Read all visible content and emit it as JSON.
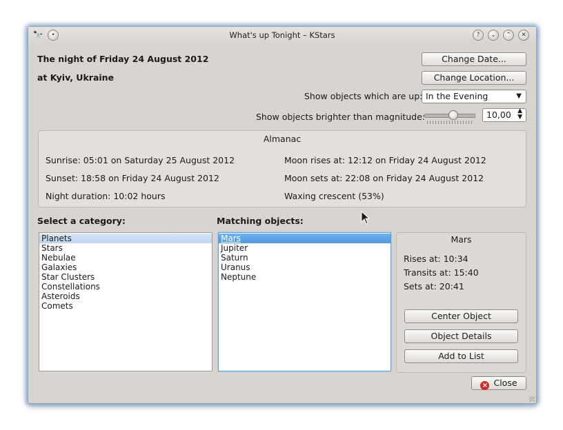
{
  "window": {
    "title": "What's up Tonight – KStars"
  },
  "header": {
    "night_label": "The night of Friday 24 August 2012",
    "location_label": "at Kyiv, Ukraine",
    "change_date": "Change Date...",
    "change_location": "Change Location...",
    "show_objects_label": "Show objects which are up:",
    "time_selected": "In the Evening",
    "brighter_label": "Show objects brighter than magnitude:",
    "magnitude_value": "10,00",
    "magnitude_slider_fraction": 0.6
  },
  "almanac": {
    "title": "Almanac",
    "sunrise": "Sunrise: 05:01 on Saturday 25 August 2012",
    "sunset": "Sunset: 18:58 on Friday 24 August 2012",
    "night_duration": "Night duration: 10:02 hours",
    "moon_rises": "Moon rises at: 12:12 on Friday 24 August 2012",
    "moon_sets": "Moon sets at: 22:08 on Friday 24 August 2012",
    "moon_phase": "Waxing crescent (53%)"
  },
  "categories": {
    "label": "Select a category:",
    "items": [
      "Planets",
      "Stars",
      "Nebulae",
      "Galaxies",
      "Star Clusters",
      "Constellations",
      "Asteroids",
      "Comets"
    ],
    "selected": "Planets"
  },
  "matches": {
    "label": "Matching objects:",
    "items": [
      "Mars",
      "Jupiter",
      "Saturn",
      "Uranus",
      "Neptune"
    ],
    "selected": "Mars"
  },
  "details": {
    "name": "Mars",
    "rises": "Rises at: 10:34",
    "transits": "Transits at: 15:40",
    "sets": "Sets at: 20:41",
    "center_object": "Center Object",
    "object_details": "Object Details",
    "add_to_list": "Add to List"
  },
  "footer": {
    "close": "Close"
  },
  "icons": {
    "app": "telescope-icon",
    "pin": "pin-icon",
    "help": "help-icon",
    "minimize": "minimize-icon",
    "maximize": "maximize-icon",
    "close": "close-icon"
  }
}
